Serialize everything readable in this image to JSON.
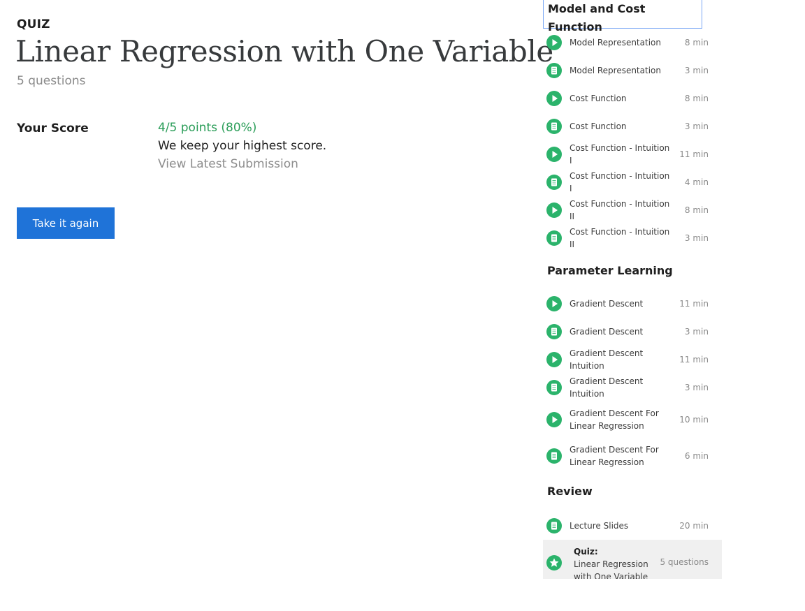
{
  "main": {
    "kicker": "QUIZ",
    "title": "Linear Regression with One Variable",
    "subtitle": "5 questions",
    "score_label": "Your Score",
    "score_value": "4/5 points (80%)",
    "score_note": "We keep your highest score.",
    "submission_link": "View Latest Submission",
    "retake_button": "Take it again"
  },
  "sidebar": {
    "sections": [
      {
        "title": "Model and Cost Function",
        "items": [
          {
            "type": "video",
            "label": "Model Representation",
            "duration": "8 min"
          },
          {
            "type": "reading",
            "label": "Model Representation",
            "duration": "3 min"
          },
          {
            "type": "video",
            "label": "Cost Function",
            "duration": "8 min"
          },
          {
            "type": "reading",
            "label": "Cost Function",
            "duration": "3 min"
          },
          {
            "type": "video",
            "label": "Cost Function - Intuition I",
            "duration": "11 min"
          },
          {
            "type": "reading",
            "label": "Cost Function - Intuition I",
            "duration": "4 min"
          },
          {
            "type": "video",
            "label": "Cost Function - Intuition II",
            "duration": "8 min"
          },
          {
            "type": "reading",
            "label": "Cost Function - Intuition II",
            "duration": "3 min"
          }
        ]
      },
      {
        "title": "Parameter Learning",
        "items": [
          {
            "type": "video",
            "label": "Gradient Descent",
            "duration": "11 min"
          },
          {
            "type": "reading",
            "label": "Gradient Descent",
            "duration": "3 min"
          },
          {
            "type": "video",
            "label": "Gradient Descent Intuition",
            "duration": "11 min"
          },
          {
            "type": "reading",
            "label": "Gradient Descent Intuition",
            "duration": "3 min"
          },
          {
            "type": "video",
            "label": "Gradient Descent For Linear Regression",
            "duration": "10 min"
          },
          {
            "type": "reading",
            "label": "Gradient Descent For Linear Regression",
            "duration": "6 min"
          }
        ]
      },
      {
        "title": "Review",
        "items": [
          {
            "type": "reading",
            "label": "Lecture Slides",
            "duration": "20 min"
          }
        ]
      }
    ],
    "quiz": {
      "prefix": "Quiz:",
      "label": "Linear Regression with One Variable",
      "duration": "5 questions"
    }
  },
  "colors": {
    "accent_green": "#2bb36b",
    "score_green": "#2a9d58",
    "button_blue": "#1f73d8",
    "focus_outline": "#7aa7f5"
  }
}
